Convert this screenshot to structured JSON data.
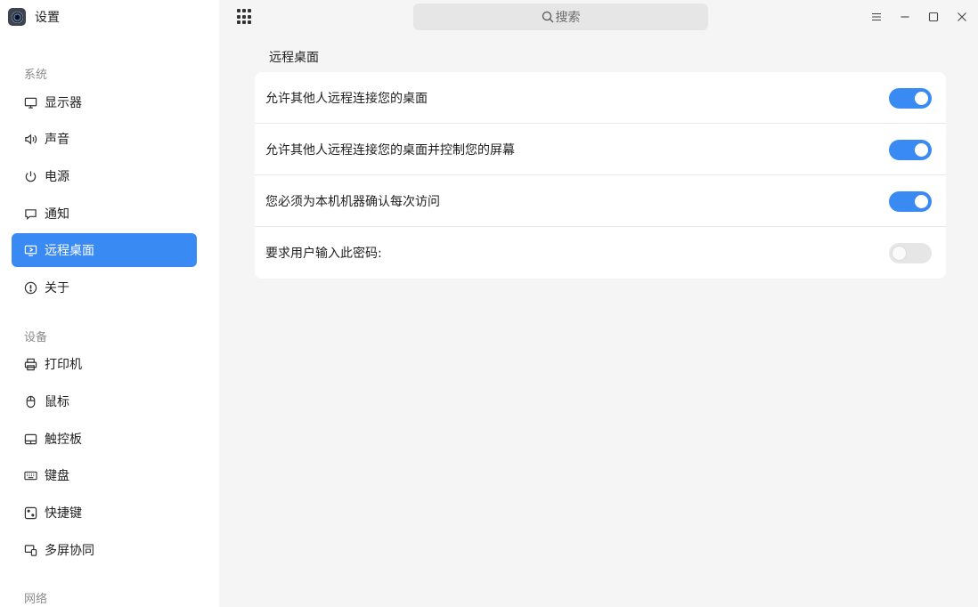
{
  "app": {
    "title": "设置"
  },
  "search": {
    "placeholder": "搜索"
  },
  "sidebar": {
    "sections": [
      {
        "title": "系统"
      },
      {
        "title": "设备"
      },
      {
        "title": "网络"
      }
    ],
    "items": [
      {
        "label": "显示器",
        "icon": "monitor-icon"
      },
      {
        "label": "声音",
        "icon": "speaker-icon"
      },
      {
        "label": "电源",
        "icon": "power-icon"
      },
      {
        "label": "通知",
        "icon": "notification-icon"
      },
      {
        "label": "远程桌面",
        "icon": "remote-desktop-icon",
        "active": true
      },
      {
        "label": "关于",
        "icon": "info-icon"
      },
      {
        "label": "打印机",
        "icon": "printer-icon"
      },
      {
        "label": "鼠标",
        "icon": "mouse-icon"
      },
      {
        "label": "触控板",
        "icon": "touchpad-icon"
      },
      {
        "label": "键盘",
        "icon": "keyboard-icon"
      },
      {
        "label": "快捷键",
        "icon": "shortcut-icon"
      },
      {
        "label": "多屏协同",
        "icon": "multiscreen-icon"
      }
    ]
  },
  "content": {
    "title": "远程桌面",
    "settings": [
      {
        "label": "允许其他人远程连接您的桌面",
        "enabled": true
      },
      {
        "label": "允许其他人远程连接您的桌面并控制您的屏幕",
        "enabled": true
      },
      {
        "label": "您必须为本机机器确认每次访问",
        "enabled": true
      },
      {
        "label": "要求用户输入此密码:",
        "enabled": false
      }
    ]
  },
  "colors": {
    "accent": "#3a8af4",
    "sidebar_bg": "#ffffff",
    "content_bg": "#f5f5f5"
  }
}
